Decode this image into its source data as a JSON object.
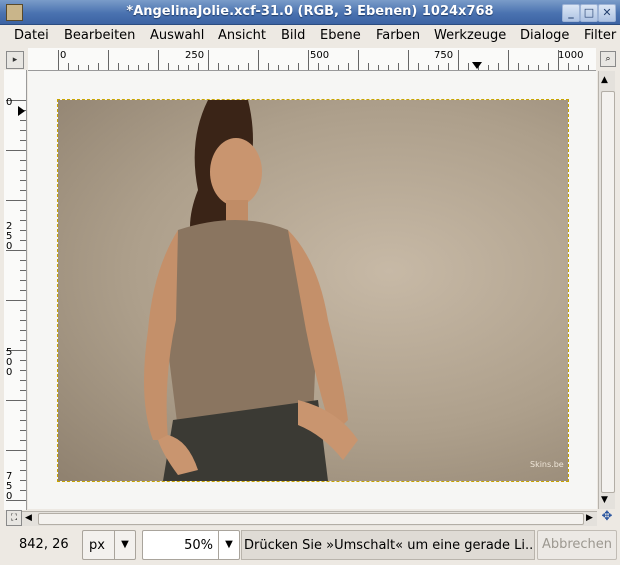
{
  "window": {
    "title": "*AngelinaJolie.xcf-31.0 (RGB, 3 Ebenen) 1024x768"
  },
  "menu": [
    "Datei",
    "Bearbeiten",
    "Auswahl",
    "Ansicht",
    "Bild",
    "Ebene",
    "Farben",
    "Werkzeuge",
    "Dialoge",
    "Filter"
  ],
  "ruler_top_labels": [
    "0",
    "250",
    "500",
    "750",
    "1000"
  ],
  "ruler_left_labels": [
    "0",
    "250",
    "500",
    "750"
  ],
  "image_watermark": "Skins.be",
  "status": {
    "coords": "842, 26",
    "unit": "px",
    "zoom": "50%",
    "message": "Drücken Sie »Umschalt« um eine gerade Li...",
    "cancel": "Abbrechen"
  }
}
